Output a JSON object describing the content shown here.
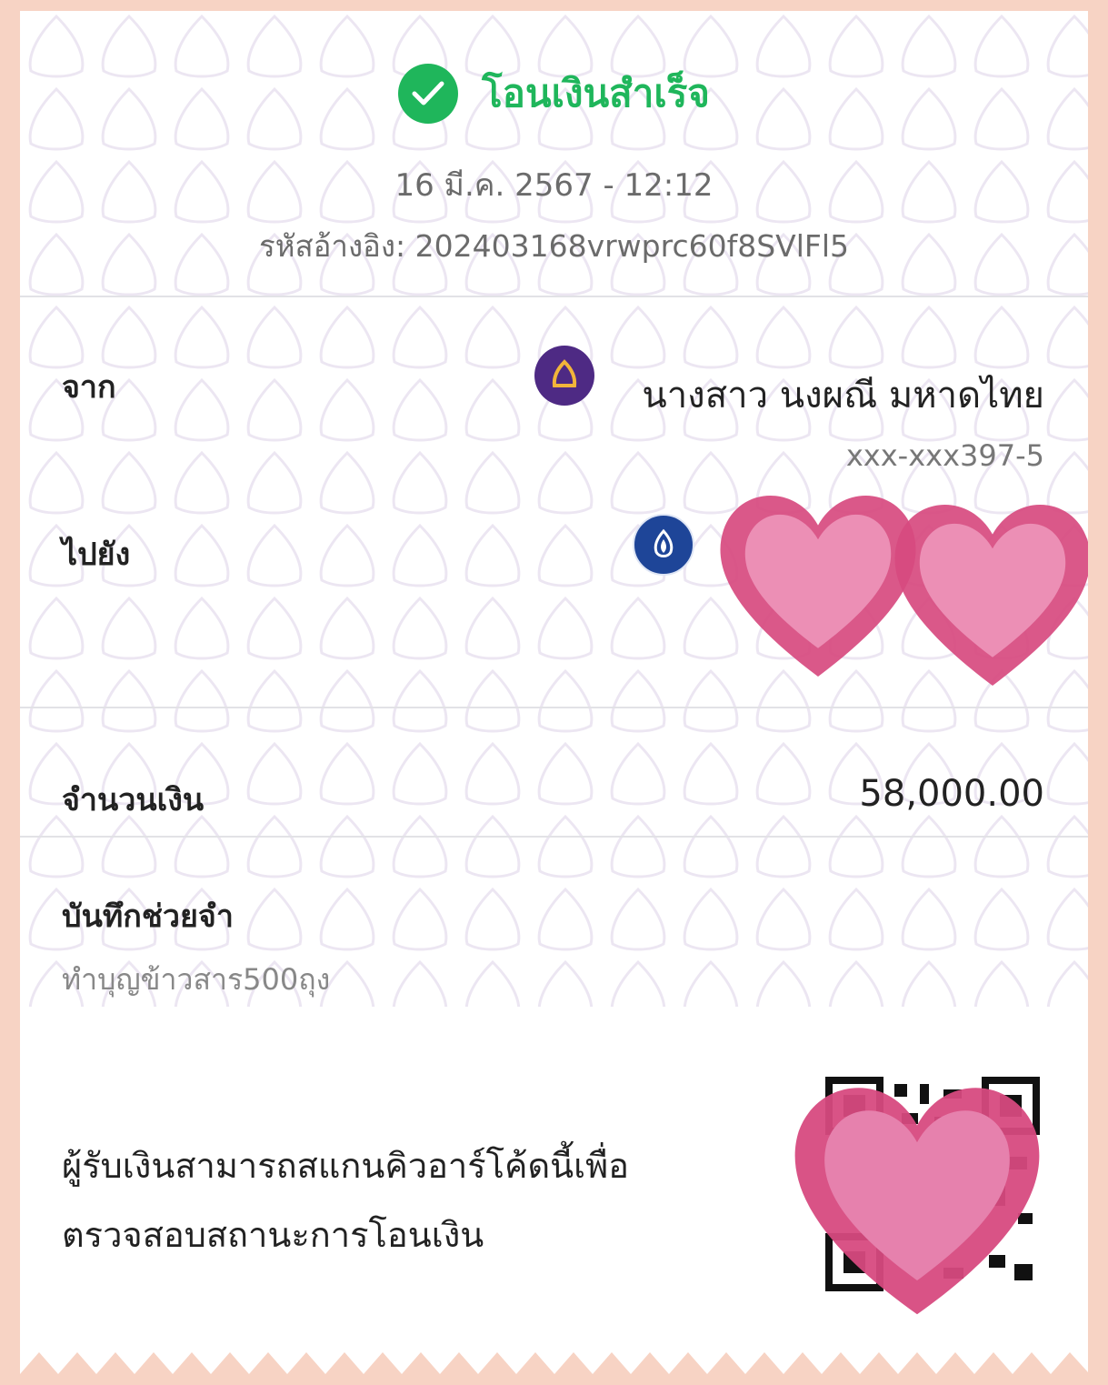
{
  "status": {
    "title": "โอนเงินสำเร็จ",
    "date_time": "16 มี.ค. 2567 - 12:12",
    "reference_label": "รหัสอ้างอิง:",
    "reference_id": "202403168vrwprc60f8SVlFl5"
  },
  "transfer": {
    "from_label": "จาก",
    "from_name": "นางสาว นงผณี มหาดไทย",
    "from_account": "xxx-xxx397-5",
    "from_bank_icon": "bank-logo-purple",
    "to_label": "ไปยัง",
    "to_bank_icon": "bank-logo-blue"
  },
  "amount": {
    "label": "จำนวนเงิน",
    "value": "58,000.00"
  },
  "memo": {
    "label": "บันทึกช่วยจำ",
    "text": "ทำบุญข้าวสาร500ถุง"
  },
  "qr": {
    "note_line1": "ผู้รับเงินสามารถสแกนคิวอาร์โค้ดนี้เพื่อ",
    "note_line2": "ตรวจสอบสถานะการโอนเงิน"
  },
  "colors": {
    "success": "#1fb65b",
    "from_bank": "#4e2a84",
    "to_bank": "#1e4598",
    "heart": "#e2638f"
  }
}
